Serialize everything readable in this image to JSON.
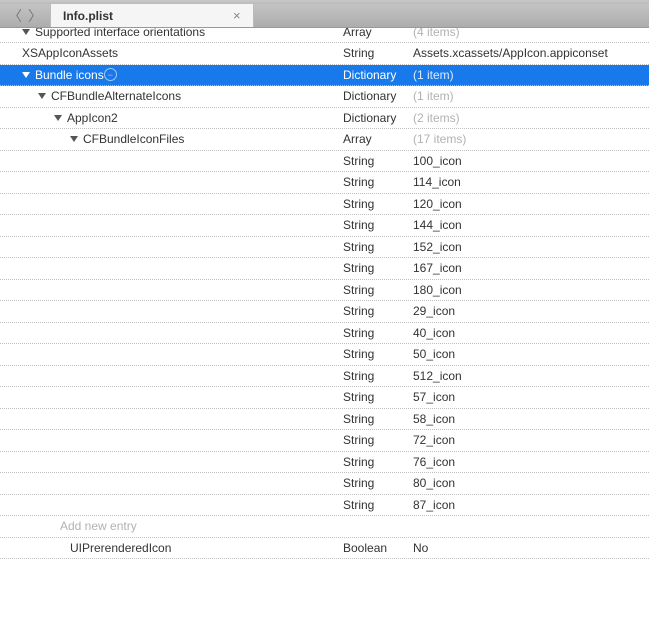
{
  "tab": {
    "title": "Info.plist"
  },
  "rows": [
    {
      "indent": 1,
      "disclosure": true,
      "key": "Supported interface orientations",
      "type": "Array",
      "value": "(4 items)",
      "valclass": "items"
    },
    {
      "indent": 1,
      "key": "XSAppIconAssets",
      "type": "String",
      "value": "Assets.xcassets/AppIcon.appiconset"
    },
    {
      "indent": 1,
      "disclosure": true,
      "selected": true,
      "key": "Bundle icons",
      "type": "Dictionary",
      "value": "(1 item)",
      "valclass": "items"
    },
    {
      "indent": 2,
      "disclosure": true,
      "key": "CFBundleAlternateIcons",
      "type": "Dictionary",
      "value": "(1 item)",
      "valclass": "items"
    },
    {
      "indent": 3,
      "disclosure": true,
      "key": "AppIcon2",
      "type": "Dictionary",
      "value": "(2 items)",
      "valclass": "items"
    },
    {
      "indent": 4,
      "disclosure": true,
      "key": "CFBundleIconFiles",
      "type": "Array",
      "value": "(17 items)",
      "valclass": "items"
    },
    {
      "indent": 4,
      "key": "",
      "type": "String",
      "value": "100_icon"
    },
    {
      "indent": 4,
      "key": "",
      "type": "String",
      "value": "114_icon"
    },
    {
      "indent": 4,
      "key": "",
      "type": "String",
      "value": "120_icon"
    },
    {
      "indent": 4,
      "key": "",
      "type": "String",
      "value": "144_icon"
    },
    {
      "indent": 4,
      "key": "",
      "type": "String",
      "value": "152_icon"
    },
    {
      "indent": 4,
      "key": "",
      "type": "String",
      "value": "167_icon"
    },
    {
      "indent": 4,
      "key": "",
      "type": "String",
      "value": "180_icon"
    },
    {
      "indent": 4,
      "key": "",
      "type": "String",
      "value": "29_icon"
    },
    {
      "indent": 4,
      "key": "",
      "type": "String",
      "value": "40_icon"
    },
    {
      "indent": 4,
      "key": "",
      "type": "String",
      "value": "50_icon"
    },
    {
      "indent": 4,
      "key": "",
      "type": "String",
      "value": "512_icon"
    },
    {
      "indent": 4,
      "key": "",
      "type": "String",
      "value": "57_icon"
    },
    {
      "indent": 4,
      "key": "",
      "type": "String",
      "value": "58_icon"
    },
    {
      "indent": 4,
      "key": "",
      "type": "String",
      "value": "72_icon"
    },
    {
      "indent": 4,
      "key": "",
      "type": "String",
      "value": "76_icon"
    },
    {
      "indent": 4,
      "key": "",
      "type": "String",
      "value": "80_icon"
    },
    {
      "indent": 4,
      "key": "",
      "type": "String",
      "value": "87_icon"
    },
    {
      "indentclass": "indentph",
      "placeholder": true,
      "key": "Add new entry"
    },
    {
      "indent": 4,
      "key": "UIPrerenderedIcon",
      "type": "Boolean",
      "value": "No"
    }
  ]
}
